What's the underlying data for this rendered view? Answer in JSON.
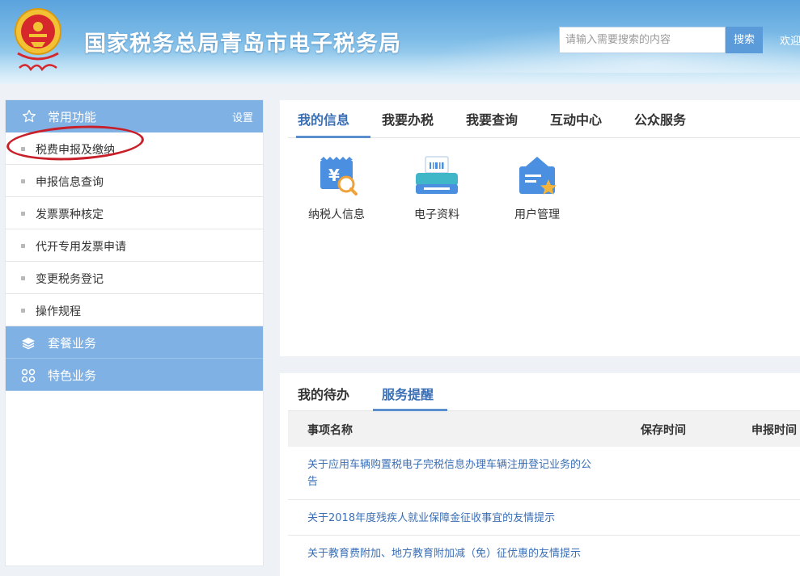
{
  "header": {
    "title": "国家税务总局青岛市电子税务局",
    "search_placeholder": "请输入需要搜索的内容",
    "search_button": "搜索",
    "welcome": "欢迎"
  },
  "sidebar": {
    "head_label": "常用功能",
    "settings_label": "设置",
    "items": [
      {
        "label": "税费申报及缴纳"
      },
      {
        "label": "申报信息查询"
      },
      {
        "label": "发票票种核定"
      },
      {
        "label": "代开专用发票申请"
      },
      {
        "label": "变更税务登记"
      },
      {
        "label": "操作规程"
      }
    ],
    "groups": [
      {
        "label": "套餐业务",
        "icon": "layers-icon"
      },
      {
        "label": "特色业务",
        "icon": "grid-icon"
      }
    ]
  },
  "main_tabs": [
    "我的信息",
    "我要办税",
    "我要查询",
    "互动中心",
    "公众服务"
  ],
  "apps": [
    {
      "label": "纳税人信息",
      "icon": "taxpayer-info-icon"
    },
    {
      "label": "电子资料",
      "icon": "printer-icon"
    },
    {
      "label": "用户管理",
      "icon": "user-management-icon"
    }
  ],
  "bottom_tabs": [
    "我的待办",
    "服务提醒"
  ],
  "table": {
    "headers": [
      "事项名称",
      "保存时间",
      "申报时间"
    ],
    "rows": [
      {
        "title": "关于应用车辆购置税电子完税信息办理车辆注册登记业务的公告"
      },
      {
        "title": "关于2018年度残疾人就业保障金征收事宜的友情提示"
      },
      {
        "title": "关于教育费附加、地方教育附加减（免）征优惠的友情提示"
      }
    ]
  },
  "colors": {
    "accent": "#3a6fb6",
    "sidebar_blue": "#7fb1e4",
    "highlight_oval": "#c8202a"
  }
}
